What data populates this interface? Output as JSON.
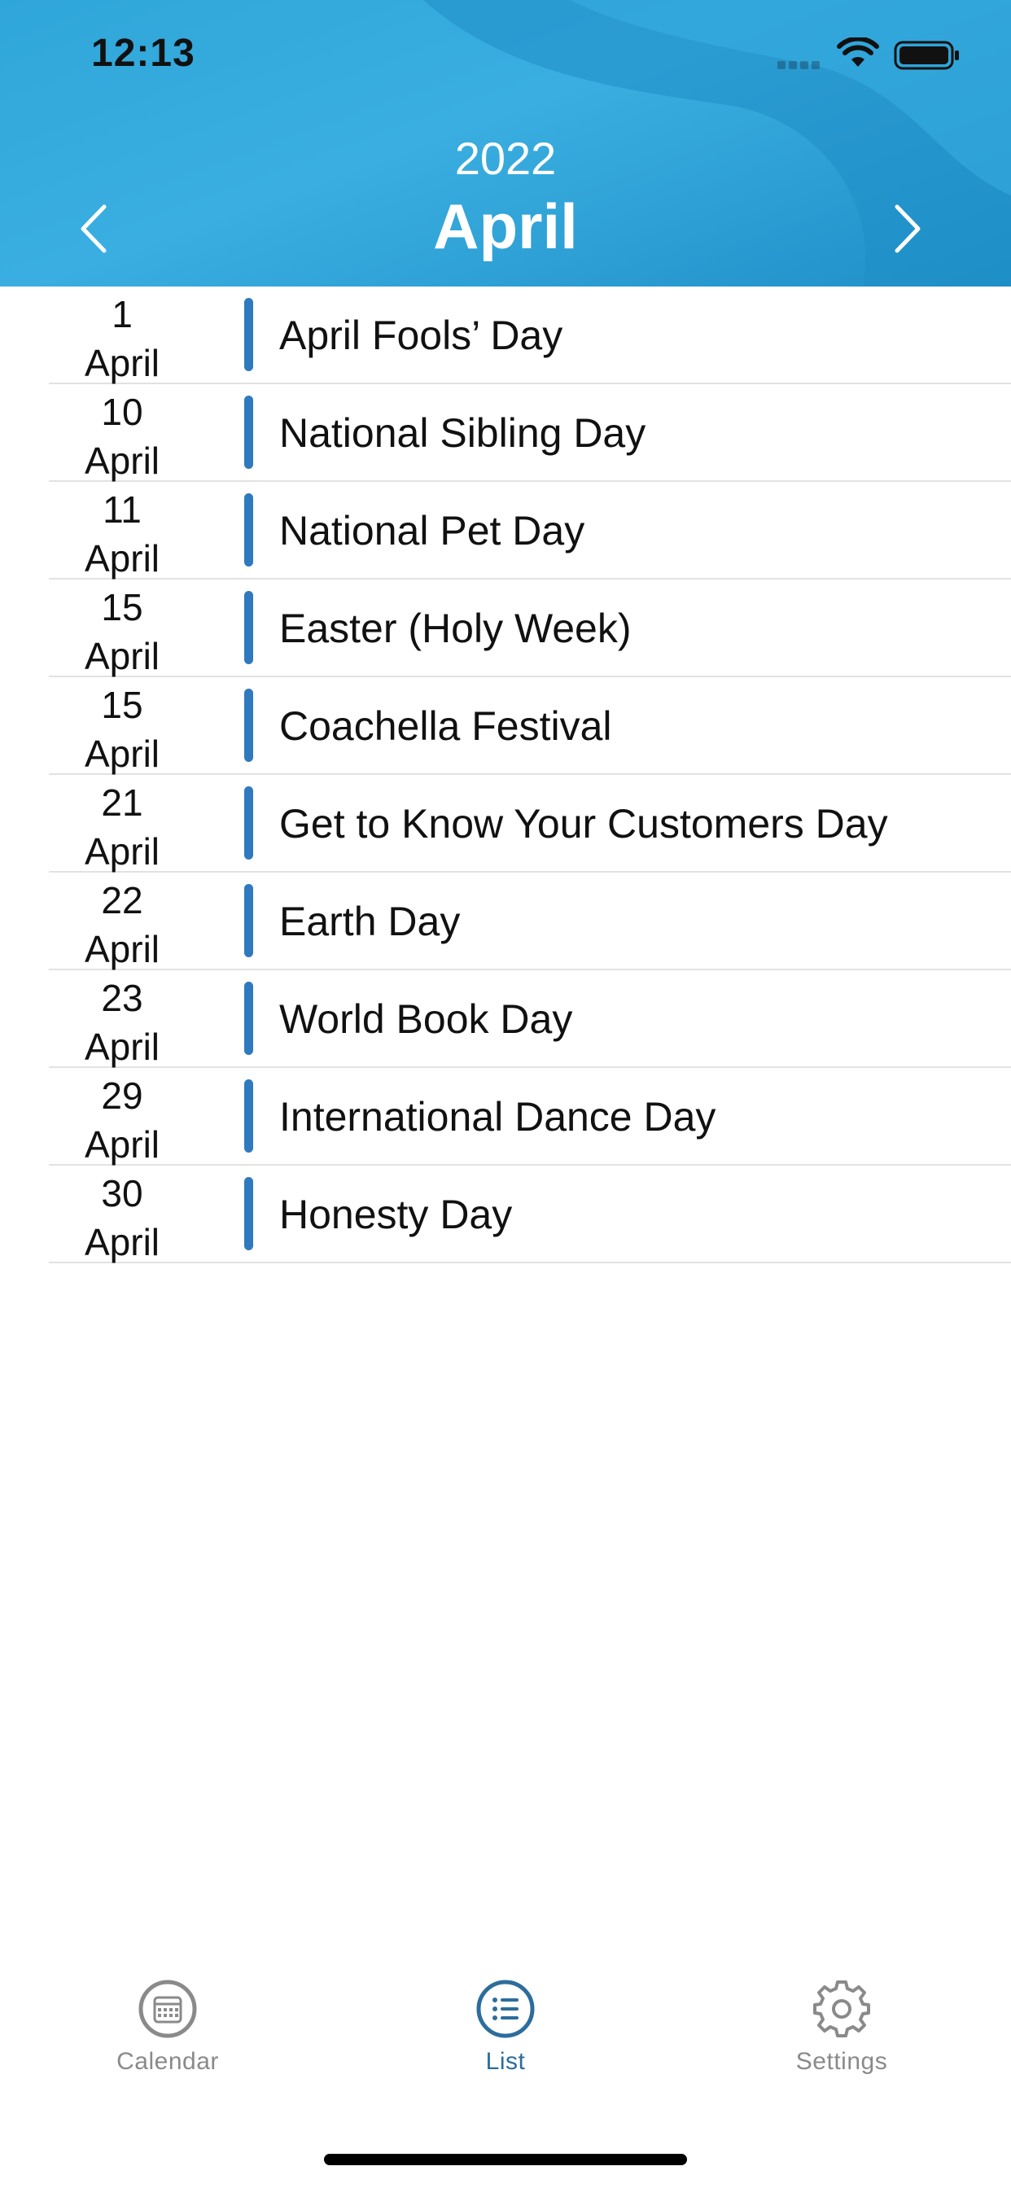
{
  "status_bar": {
    "time": "12:13"
  },
  "header": {
    "year": "2022",
    "month": "April",
    "prev_icon": "chevron-left-icon",
    "next_icon": "chevron-right-icon"
  },
  "events": [
    {
      "day": "1",
      "month": "April",
      "title": "April Fools’ Day"
    },
    {
      "day": "10",
      "month": "April",
      "title": "National Sibling Day"
    },
    {
      "day": "11",
      "month": "April",
      "title": "National Pet Day"
    },
    {
      "day": "15",
      "month": "April",
      "title": "Easter (Holy Week)"
    },
    {
      "day": "15",
      "month": "April",
      "title": "Coachella Festival"
    },
    {
      "day": "21",
      "month": "April",
      "title": "Get to Know Your Customers Day"
    },
    {
      "day": "22",
      "month": "April",
      "title": "Earth Day"
    },
    {
      "day": "23",
      "month": "April",
      "title": "World Book Day"
    },
    {
      "day": "29",
      "month": "April",
      "title": "International Dance Day"
    },
    {
      "day": "30",
      "month": "April",
      "title": "Honesty Day"
    }
  ],
  "tabs": [
    {
      "label": "Calendar",
      "icon": "calendar-icon",
      "active": false
    },
    {
      "label": "List",
      "icon": "list-icon",
      "active": true
    },
    {
      "label": "Settings",
      "icon": "gear-icon",
      "active": false
    }
  ],
  "colors": {
    "accent": "#2f7abf",
    "tab_active": "#2d6d9c",
    "tab_inactive": "#8a8a8a",
    "header": "#3aaee0"
  }
}
